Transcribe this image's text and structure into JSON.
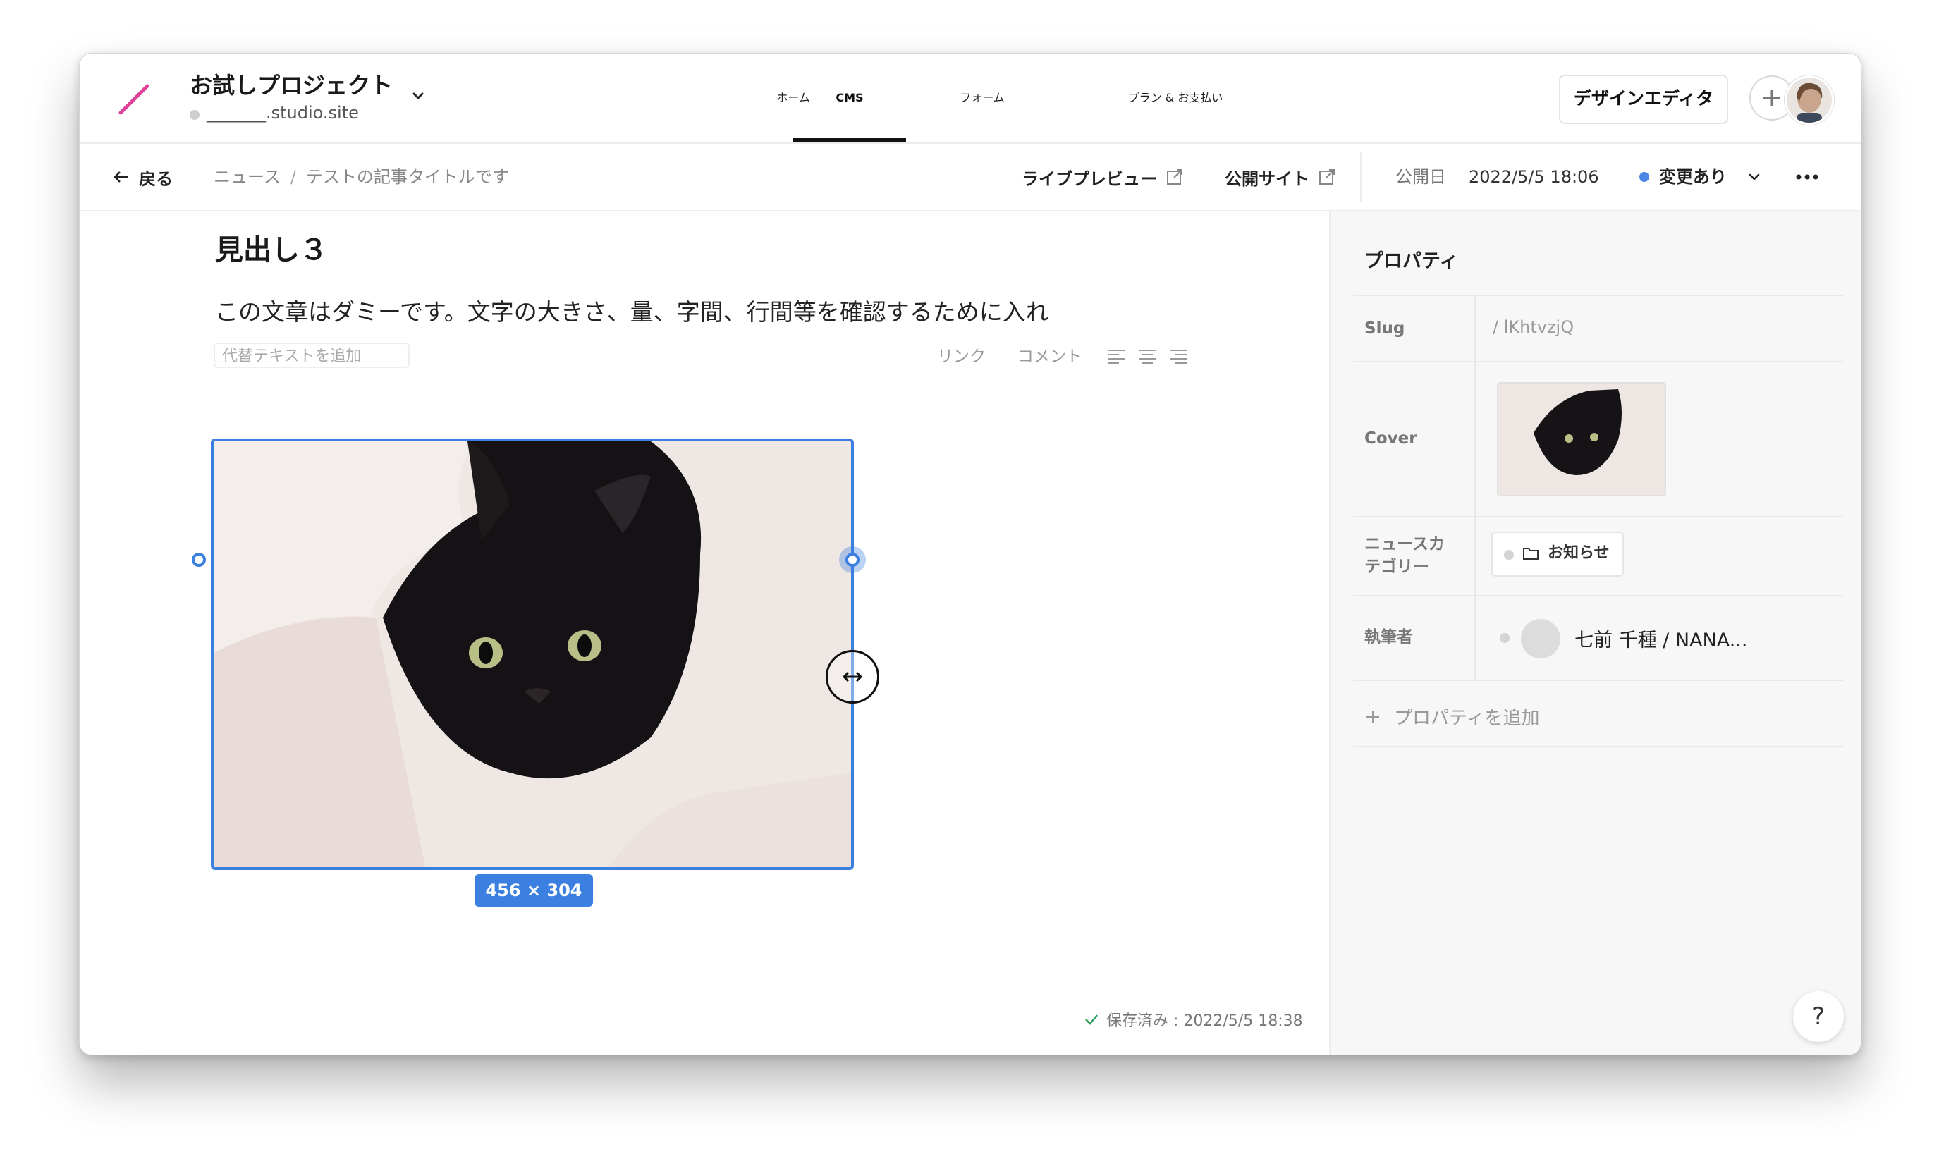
{
  "header": {
    "project_title": "お試しプロジェクト",
    "project_domain": "_______.studio.site",
    "nav": [
      {
        "label": "ホーム"
      },
      {
        "label": "CMS"
      },
      {
        "label": "フォーム"
      },
      {
        "label": "プラン & お支払い"
      }
    ],
    "active_tab": "CMS",
    "design_editor_label": "デザインエディタ"
  },
  "subbar": {
    "back_label": "戻る",
    "breadcrumb": [
      "ニュース",
      "テストの記事タイトルです"
    ],
    "breadcrumb_sep": "/",
    "live_preview_label": "ライブプレビュー",
    "public_site_label": "公開サイト",
    "published_label": "公開日",
    "published_date": "2022/5/5 18:06",
    "status_label": "変更あり"
  },
  "editor": {
    "heading": "見出し３",
    "paragraph": "この文章はダミーです。文字の大きさ、量、字間、行間等を確認するために入れ",
    "alt_placeholder": "代替テキストを追加",
    "toolbar": {
      "link": "リンク",
      "comment": "コメント"
    },
    "image_size": "456 × 304",
    "saved_text": "保存済み : 2022/5/5 18:38"
  },
  "panel": {
    "title": "プロパティ",
    "slug": {
      "label": "Slug",
      "value": "/ lKhtvzjQ"
    },
    "cover": {
      "label": "Cover"
    },
    "category": {
      "label_line1": "ニュースカ",
      "label_line2": "テゴリー",
      "value": "お知らせ"
    },
    "author": {
      "label": "執筆者",
      "value": "七前 千種 / NANA..."
    },
    "add_property": "プロパティを追加",
    "help": "?"
  },
  "colors": {
    "accent": "#3b7fe0",
    "logo": "#e0409a",
    "status_dot": "#4a86e8",
    "saved_check": "#2e9e5b"
  }
}
